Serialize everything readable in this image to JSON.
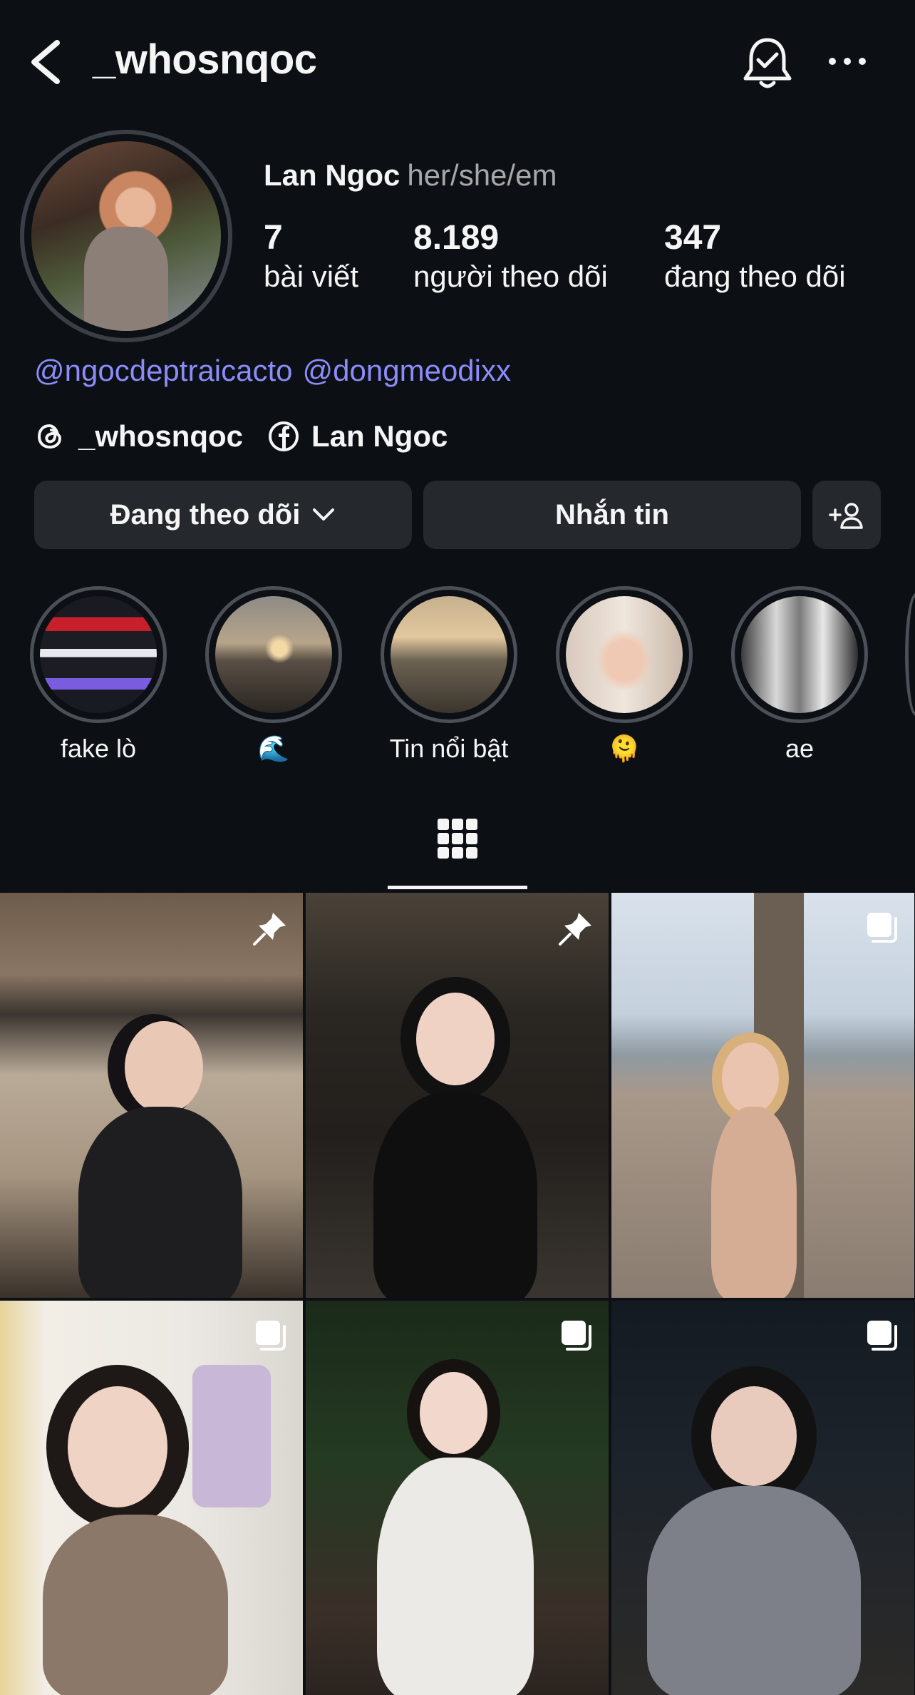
{
  "header": {
    "username": "_whosnqoc"
  },
  "profile": {
    "display_name": "Lan Ngoc",
    "pronouns": "her/she/em",
    "stats": [
      {
        "value": "7",
        "label": "bài viết"
      },
      {
        "value": "8.189",
        "label": "người theo dõi"
      },
      {
        "value": "347",
        "label": "đang theo dõi"
      }
    ],
    "mentions": [
      "@ngocdeptraicacto",
      "@dongmeodixx"
    ],
    "links": [
      {
        "icon": "threads-icon",
        "text": "_whosnqoc"
      },
      {
        "icon": "facebook-icon",
        "text": "Lan Ngoc"
      }
    ]
  },
  "actions": {
    "following_label": "Đang theo dõi",
    "message_label": "Nhắn tin"
  },
  "highlights": [
    {
      "label": "fake lò"
    },
    {
      "label": "🌊"
    },
    {
      "label": "Tin nổi bật"
    },
    {
      "label": "🫠"
    },
    {
      "label": "ae"
    }
  ],
  "posts": [
    {
      "badge": "pin-icon"
    },
    {
      "badge": "pin-icon"
    },
    {
      "badge": "multi-photo-icon"
    },
    {
      "badge": "multi-photo-icon"
    },
    {
      "badge": "multi-photo-icon"
    },
    {
      "badge": "multi-photo-icon"
    }
  ],
  "colors": {
    "background": "#0c1014",
    "button": "#25292e",
    "mention": "#8b8cf9",
    "secondary_text": "#a8a8a8"
  }
}
